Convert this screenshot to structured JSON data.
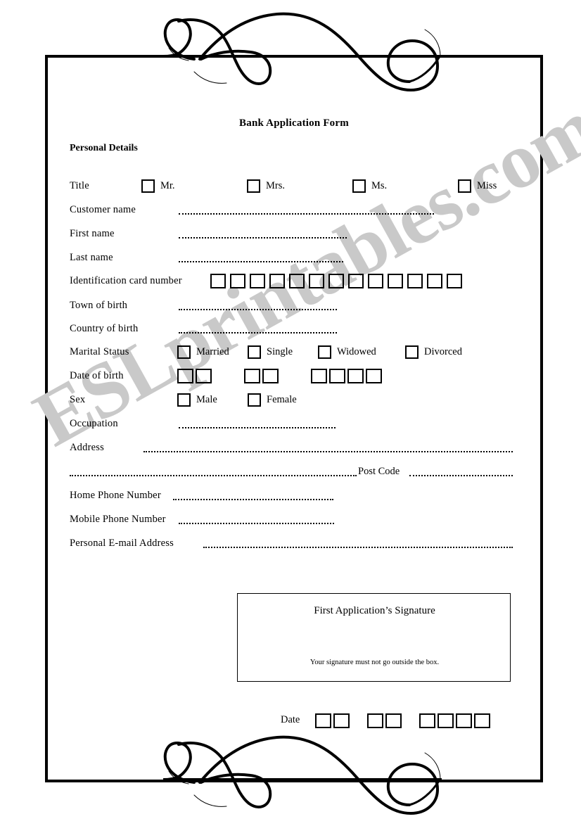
{
  "document": {
    "title": "Bank Application Form",
    "section_heading": "Personal Details",
    "watermark": "ESLprintables.com",
    "accent_color": "#000000",
    "watermark_color": "#c9c9c9",
    "page_background": "#ffffff"
  },
  "decoration": {
    "top_flourish": "swirl-flourish",
    "bottom_flourish": "swirl-flourish"
  },
  "fields": {
    "title": {
      "label": "Title",
      "options": [
        "Mr.",
        "Mrs.",
        "Ms.",
        "Miss"
      ]
    },
    "customer_name": {
      "label": "Customer name",
      "value": ""
    },
    "first_name": {
      "label": "First name",
      "value": ""
    },
    "last_name": {
      "label": "Last name",
      "value": ""
    },
    "id_card_number": {
      "label": "Identification card number",
      "box_count": 13,
      "value": ""
    },
    "town_of_birth": {
      "label": "Town of birth",
      "value": ""
    },
    "country_of_birth": {
      "label": "Country of birth",
      "value": ""
    },
    "marital_status": {
      "label": "Marital Status",
      "options": [
        "Married",
        "Single",
        "Widowed",
        "Divorced"
      ]
    },
    "date_of_birth": {
      "label": "Date of birth",
      "groups": [
        2,
        2,
        4
      ]
    },
    "sex": {
      "label": "Sex",
      "options": [
        "Male",
        "Female"
      ]
    },
    "occupation": {
      "label": "Occupation",
      "value": ""
    },
    "address": {
      "label": "Address",
      "value": ""
    },
    "post_code": {
      "label": "Post Code",
      "value": ""
    },
    "home_phone": {
      "label": "Home Phone Number",
      "value": ""
    },
    "mobile_phone": {
      "label": "Mobile Phone Number",
      "value": ""
    },
    "email": {
      "label": "Personal E-mail Address",
      "value": ""
    }
  },
  "signature": {
    "title": "First Application’s Signature",
    "note": "Your signature must not go outside the box."
  },
  "footer_date": {
    "label": "Date",
    "groups": [
      2,
      2,
      4
    ]
  }
}
